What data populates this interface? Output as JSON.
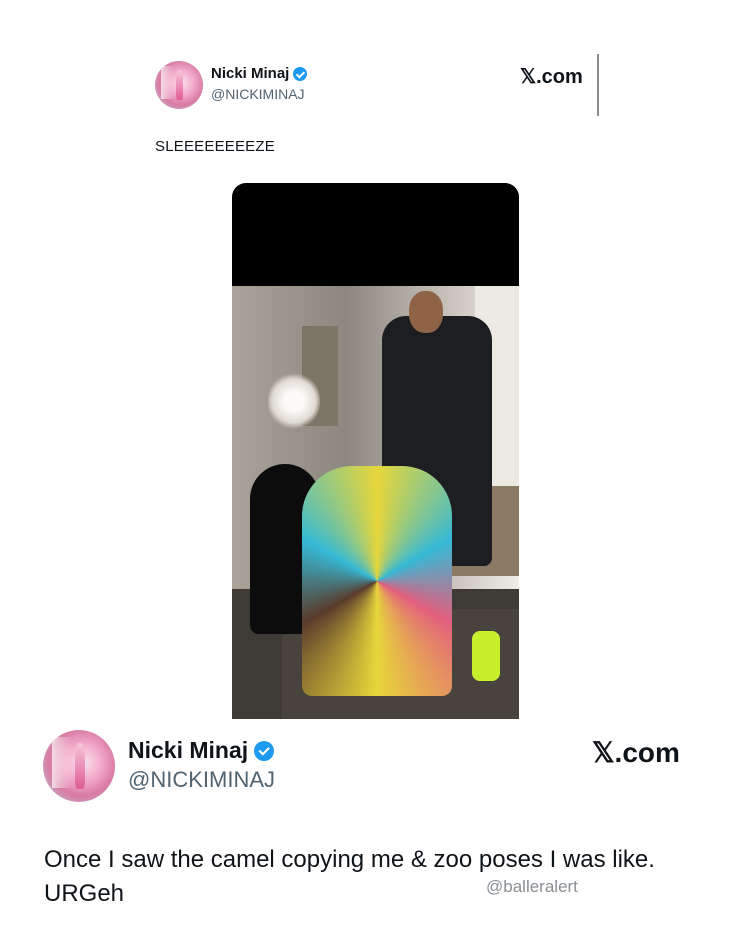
{
  "embedded_tweet": {
    "author_name": "Nicki Minaj",
    "handle": "@NICKIMINAJ",
    "site_label": "𝕏.com",
    "text": "SLEEEEEEEEZE"
  },
  "main_tweet": {
    "author_name": "Nicki Minaj",
    "handle": "@NICKIMINAJ",
    "site_label": "𝕏.com",
    "text": "Once I saw the camel copying me & zoo poses I was like. URGeh"
  },
  "watermark": "@balleralert",
  "icons": {
    "verified": "verified-badge-icon",
    "site": "x-logo-icon"
  },
  "colors": {
    "verified_blue": "#1d9bf0",
    "handle_gray": "#536471",
    "text": "#0f1419"
  }
}
